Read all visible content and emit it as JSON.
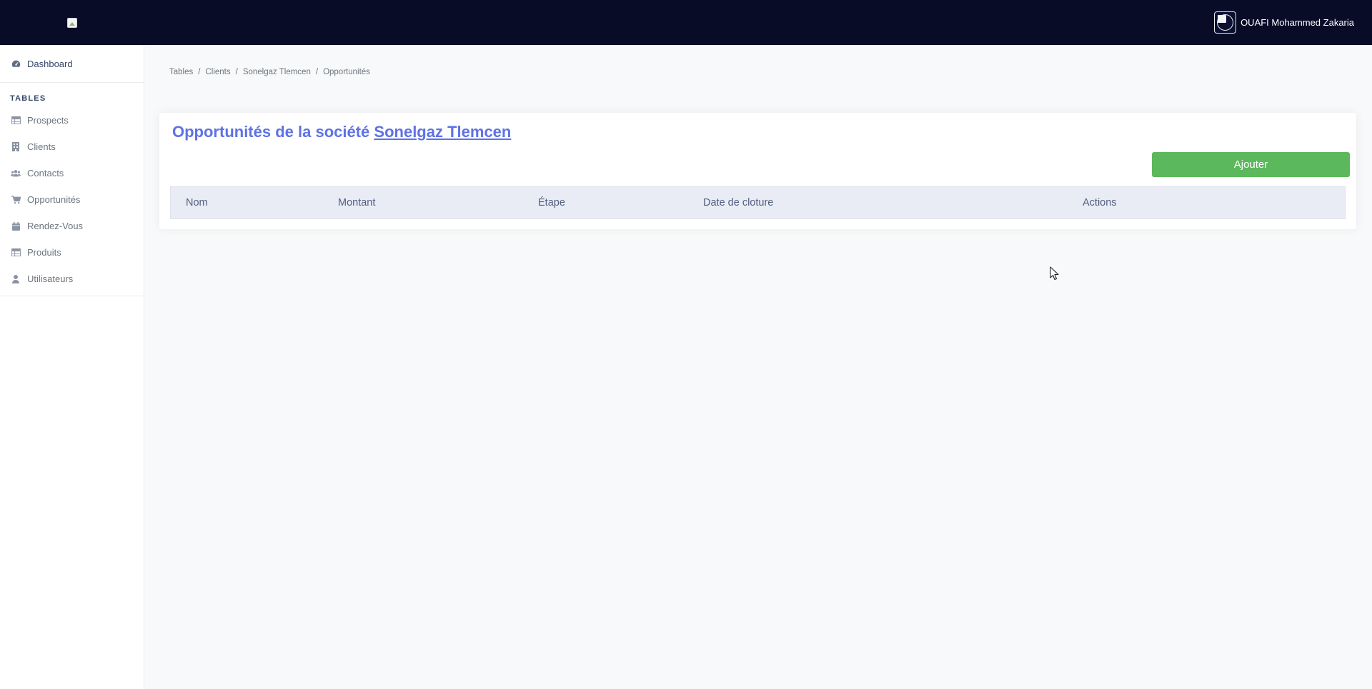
{
  "header": {
    "user_name": "OUAFI Mohammed Zakaria"
  },
  "sidebar": {
    "dashboard_label": "Dashboard",
    "section_title": "TABLES",
    "items": [
      {
        "label": "Prospects",
        "icon": "table-icon"
      },
      {
        "label": "Clients",
        "icon": "building-icon"
      },
      {
        "label": "Contacts",
        "icon": "users-icon"
      },
      {
        "label": "Opportunités",
        "icon": "cart-icon"
      },
      {
        "label": "Rendez-Vous",
        "icon": "calendar-icon"
      },
      {
        "label": "Produits",
        "icon": "table-icon"
      },
      {
        "label": "Utilisateurs",
        "icon": "user-icon"
      }
    ]
  },
  "breadcrumb": [
    "Tables",
    "Clients",
    "Sonelgaz Tlemcen",
    "Opportunités"
  ],
  "main": {
    "title_prefix": "Opportunités de la société",
    "company": "Sonelgaz Tlemcen",
    "add_button": "Ajouter",
    "table_headers": [
      "Nom",
      "Montant",
      "Étape",
      "Date de cloture",
      "Actions"
    ]
  },
  "colors": {
    "topbar": "#080c27",
    "accent": "#5e72e4",
    "success": "#5cb85c"
  }
}
